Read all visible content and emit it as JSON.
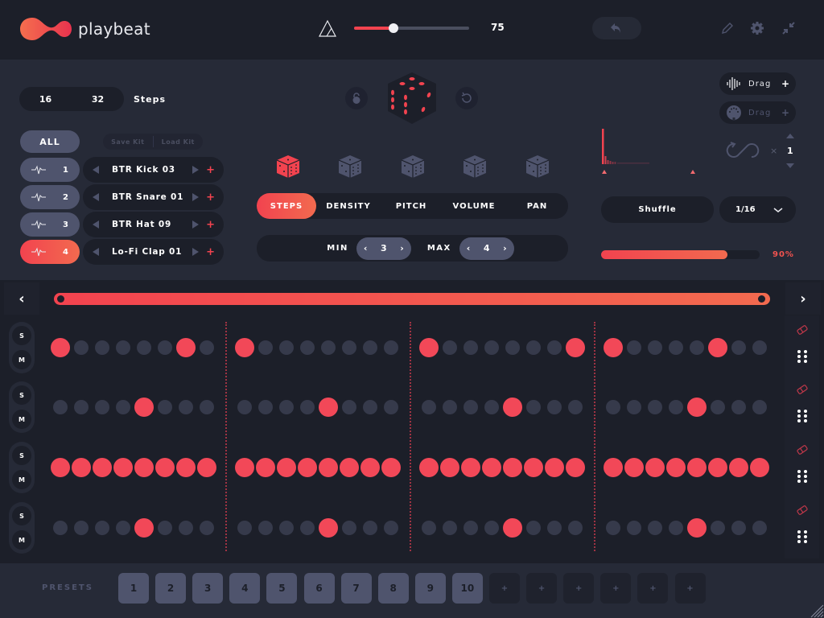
{
  "app": {
    "name": "playbeat"
  },
  "header": {
    "tempo_value": "75",
    "tempo_fraction": 0.34,
    "icons": [
      "tempo-icon",
      "undo-icon",
      "pencil-icon",
      "gear-icon",
      "collapse-icon"
    ]
  },
  "steps": {
    "options": [
      "16",
      "32"
    ],
    "label": "Steps"
  },
  "kit": {
    "all_label": "ALL",
    "save_label": "Save Kit",
    "load_label": "Load Kit"
  },
  "tracks": [
    {
      "number": "1",
      "sample": "BTR Kick 03",
      "active": false
    },
    {
      "number": "2",
      "sample": "BTR Snare 01",
      "active": false
    },
    {
      "number": "3",
      "sample": "BTR Hat 09",
      "active": false
    },
    {
      "number": "4",
      "sample": "Lo-Fi Clap 01",
      "active": true
    }
  ],
  "sample_add_label": "+",
  "modes": {
    "tabs": [
      "STEPS",
      "DENSITY",
      "PITCH",
      "VOLUME",
      "PAN"
    ],
    "active": "STEPS"
  },
  "minmax": {
    "min_label": "MIN",
    "min_value": "3",
    "max_label": "MAX",
    "max_value": "4",
    "dec": "‹",
    "inc": "›"
  },
  "export": {
    "audio_drag_label": "Drag",
    "midi_drag_label": "Drag",
    "add": "+"
  },
  "loop": {
    "x_label": "×",
    "count": "1"
  },
  "shuffle_label": "Shuffle",
  "grid": {
    "value": "1/16"
  },
  "swing": {
    "value": "90%",
    "fraction": 0.9
  },
  "sequencer": {
    "nav_prev": "‹",
    "nav_next": "›",
    "solo_label": "S",
    "mute_label": "M",
    "rows": [
      [
        1,
        0,
        0,
        0,
        0,
        0,
        1,
        0,
        1,
        0,
        0,
        0,
        0,
        0,
        0,
        0,
        1,
        0,
        0,
        0,
        0,
        0,
        0,
        1,
        1,
        0,
        0,
        0,
        0,
        1,
        0,
        0
      ],
      [
        0,
        0,
        0,
        0,
        1,
        0,
        0,
        0,
        0,
        0,
        0,
        0,
        1,
        0,
        0,
        0,
        0,
        0,
        0,
        0,
        1,
        0,
        0,
        0,
        0,
        0,
        0,
        0,
        1,
        0,
        0,
        0
      ],
      [
        1,
        1,
        1,
        1,
        1,
        1,
        1,
        1,
        1,
        1,
        1,
        1,
        1,
        1,
        1,
        1,
        1,
        1,
        1,
        1,
        1,
        1,
        1,
        1,
        1,
        1,
        1,
        1,
        1,
        1,
        1,
        1
      ],
      [
        0,
        0,
        0,
        0,
        1,
        0,
        0,
        0,
        0,
        0,
        0,
        0,
        1,
        0,
        0,
        0,
        0,
        0,
        0,
        0,
        1,
        0,
        0,
        0,
        0,
        0,
        0,
        0,
        1,
        0,
        0,
        0
      ]
    ]
  },
  "presets": {
    "label": "PRESETS",
    "slots": [
      "1",
      "2",
      "3",
      "4",
      "5",
      "6",
      "7",
      "8",
      "9",
      "10",
      "+",
      "+",
      "+",
      "+",
      "+",
      "+"
    ]
  },
  "colors": {
    "accent": "#f2434f",
    "accent2": "#f26a4f",
    "panel": "#1c1f29",
    "bg": "#262a37",
    "muted": "#4f546d"
  }
}
